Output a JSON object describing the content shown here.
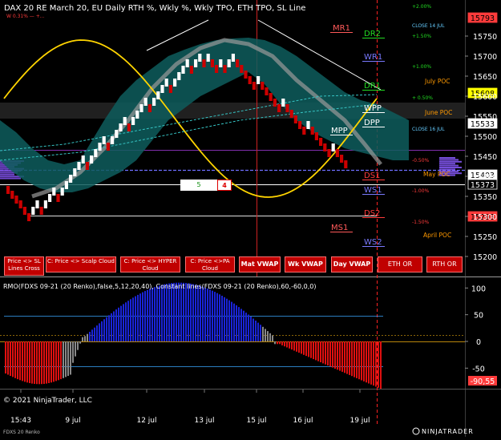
{
  "header": {
    "title": "DAX 20 RE March 20, EU Daily RTH %, Wkly %, Wkly TPO, ETH TPO, SL Line",
    "sub_title": "W 0.31%  —  +..."
  },
  "chart_data": {
    "type": "renko",
    "instrument": "FDXS 09-21 (20 Renko)",
    "x_tick_labels": [
      "15:43",
      "9 jul",
      "12 jul",
      "13 jul",
      "15 jul",
      "16 jul",
      "19 jul"
    ],
    "y_tick_labels": [
      15750,
      15700,
      15650,
      15600,
      15550,
      15500,
      15450,
      15400,
      15350,
      15300,
      15250,
      15200
    ],
    "price_tags": [
      {
        "value": "15793",
        "color": "#ff3b3b",
        "text": "#000000"
      },
      {
        "value": "15608",
        "color": "#ffff00",
        "text": "#000000"
      },
      {
        "value": "15533",
        "color": "#ffffff",
        "text": "#000000"
      },
      {
        "value": "15403",
        "color": "#ffffff",
        "text": "#000000"
      },
      {
        "value": "15373",
        "color": "#000000",
        "text": "#ffffff"
      },
      {
        "value": "15293",
        "color": "#ff3b3b",
        "text": "#000000"
      }
    ],
    "levels": [
      {
        "label": "MR1",
        "color": "#ff5a5a"
      },
      {
        "label": "DR2",
        "color": "#22dd22"
      },
      {
        "label": "WR1",
        "color": "#7a7aff"
      },
      {
        "label": "DR1",
        "color": "#22dd22"
      },
      {
        "label": "WPP",
        "color": "#ffffff"
      },
      {
        "label": "DPP",
        "color": "#ffffff"
      },
      {
        "label": "MPP",
        "color": "#ffffff"
      },
      {
        "label": "DS1",
        "color": "#ff3b3b"
      },
      {
        "label": "WS1",
        "color": "#7a7aff"
      },
      {
        "label": "DS2",
        "color": "#ff3b3b"
      },
      {
        "label": "MS1",
        "color": "#ff5a5a"
      },
      {
        "label": "WS2",
        "color": "#7a7aff"
      }
    ],
    "pct_labels": [
      {
        "text": "+2.00%",
        "color": "#22dd22"
      },
      {
        "text": "CLOSE 14 JUL",
        "color": "#66ccff"
      },
      {
        "text": "+1.50%",
        "color": "#22dd22"
      },
      {
        "text": "+1.00%",
        "color": "#22dd22"
      },
      {
        "text": "+ 0.50%",
        "color": "#22dd22"
      },
      {
        "text": "CLOSE 16 JUL",
        "color": "#66ccff"
      },
      {
        "text": "-0.50%",
        "color": "#ff3b3b"
      },
      {
        "text": "-1.00%",
        "color": "#ff3b3b"
      },
      {
        "text": "-1.50%",
        "color": "#ff3b3b"
      }
    ],
    "poc_labels": [
      {
        "text": "July POC",
        "color": "#ff9900"
      },
      {
        "text": "June POC",
        "color": "#ff9900"
      },
      {
        "text": "May POC",
        "color": "#ff9900"
      },
      {
        "text": "April POC",
        "color": "#ff9900"
      }
    ],
    "renko_bricks": [
      {
        "dir": "down",
        "count": 4,
        "color": "#cc0000"
      },
      {
        "dir": "up",
        "count": 30,
        "color": "#ffffff"
      },
      {
        "dir": "down",
        "count": 26,
        "color": "#cc0000"
      }
    ],
    "indicator": {
      "title": "RMO(FDXS 09-21 (20 Renko),false,5,12,20,40), Constant lines(FDXS 09-21 (20 Renko),60,-60,0,0)",
      "y_tick_labels": [
        100,
        50,
        0,
        -50
      ],
      "last_value": "-90,55",
      "constant_lines": [
        60,
        -60,
        0
      ]
    }
  },
  "buttons": {
    "price_sl": "Price <> SL Lines Cross",
    "scalp": "C: Price <> Scalp Cloud",
    "hyper": "C: Price <> HYPER Cloud",
    "pa": "C: Price <>PA Cloud",
    "mat_vwap": "Mat VWAP",
    "wk_vwap": "Wk VWAP",
    "day_vwap": "Day VWAP",
    "eth_or": "ETH OR",
    "rth_or": "RTH OR"
  },
  "step_boxes": {
    "left": "5",
    "right": "4"
  },
  "colors": {
    "up_brick": "#ffffff",
    "down_brick": "#cc0000",
    "cloud": "#0e5d5d",
    "sine": "#ffd400",
    "rmo_up": "#1a24d8",
    "rmo_down": "#e01010"
  },
  "footer": {
    "copyright": "© 2021 NinjaTrader, LLC",
    "instrument": "FDXS 20 Renko",
    "brand": "NINJATRADER"
  }
}
